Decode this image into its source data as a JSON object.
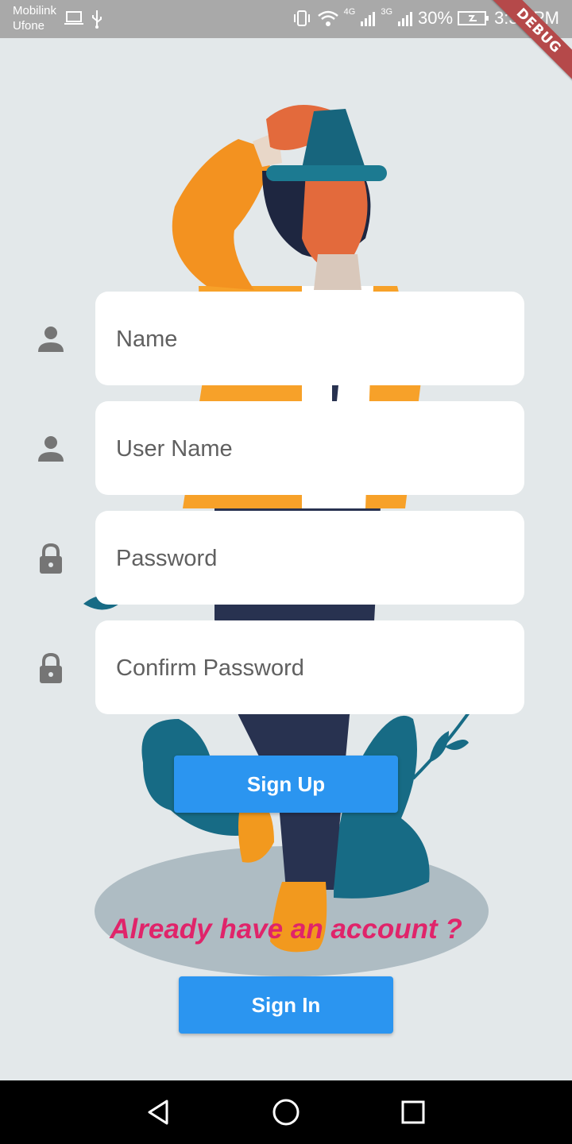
{
  "status_bar": {
    "carrier_1": "Mobilink",
    "carrier_2": "Ufone",
    "net_1": "4G",
    "net_2": "3G",
    "battery": "30%",
    "time": "3:35 PM",
    "debug_label": "DEBUG"
  },
  "form": {
    "name_placeholder": "Name",
    "username_placeholder": "User Name",
    "password_placeholder": "Password",
    "confirm_placeholder": "Confirm Password",
    "signup_label": "Sign Up",
    "already_text": "Already have an account ?",
    "signin_label": "Sign In"
  },
  "icons": {
    "name": "person-icon",
    "username": "person-icon",
    "password": "lock-icon",
    "confirm": "lock-icon",
    "nav": [
      "back-icon",
      "home-icon",
      "recents-icon"
    ]
  },
  "colors": {
    "background": "#e3e8ea",
    "button": "#2b95f0",
    "accent_text": "#e0246a",
    "status_bar": "#a9a9a9"
  }
}
